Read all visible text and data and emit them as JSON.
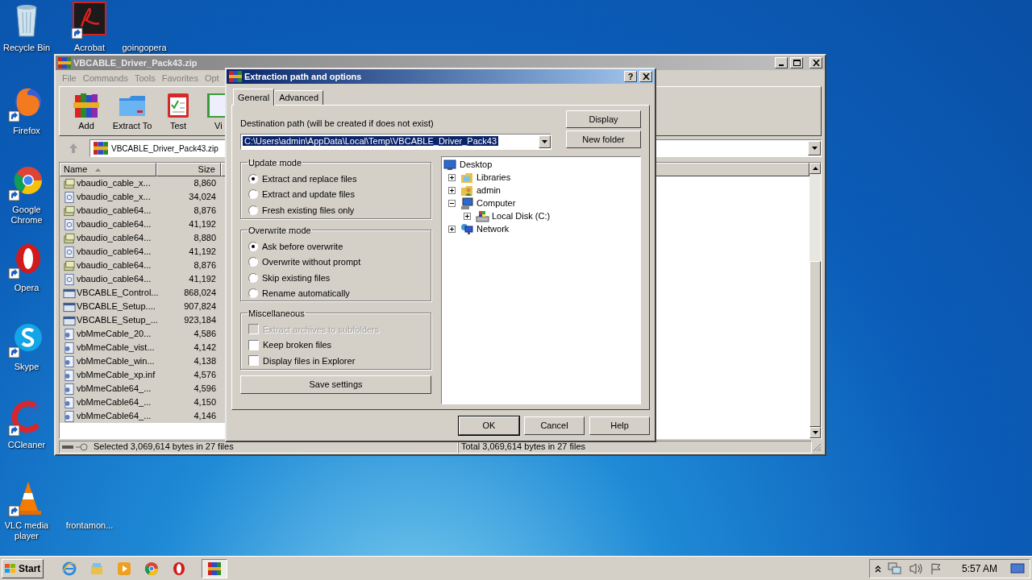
{
  "desktop_icons": [
    {
      "label": "Recycle Bin"
    },
    {
      "label": "Acrobat"
    },
    {
      "label": "goingopera"
    },
    {
      "label": "Firefox"
    },
    {
      "label": "Google Chrome"
    },
    {
      "label": "Opera"
    },
    {
      "label": "Skype"
    },
    {
      "label": "CCleaner"
    },
    {
      "label": "VLC media player"
    },
    {
      "label": "frontamon..."
    }
  ],
  "archive_window": {
    "title": "VBCABLE_Driver_Pack43.zip",
    "menu": [
      "File",
      "Commands",
      "Tools",
      "Favorites",
      "Opt"
    ],
    "toolbar": [
      "Add",
      "Extract To",
      "Test",
      "Vi"
    ],
    "address": "VBCABLE_Driver_Pack43.zip",
    "columns": [
      "Name",
      "Size"
    ],
    "rows": [
      {
        "name": "vbaudio_cable_x...",
        "size": "8,860",
        "kind": "cat",
        "selected": true
      },
      {
        "name": "vbaudio_cable_x...",
        "size": "34,024",
        "kind": "sys",
        "selected": true
      },
      {
        "name": "vbaudio_cable64...",
        "size": "8,876",
        "kind": "cat",
        "selected": true
      },
      {
        "name": "vbaudio_cable64...",
        "size": "41,192",
        "kind": "sys",
        "selected": true
      },
      {
        "name": "vbaudio_cable64...",
        "size": "8,880",
        "kind": "cat",
        "selected": true
      },
      {
        "name": "vbaudio_cable64...",
        "size": "41,192",
        "kind": "sys",
        "selected": true
      },
      {
        "name": "vbaudio_cable64...",
        "size": "8,876",
        "kind": "cat",
        "selected": true
      },
      {
        "name": "vbaudio_cable64...",
        "size": "41,192",
        "kind": "sys",
        "selected": true
      },
      {
        "name": "VBCABLE_Control...",
        "size": "868,024",
        "kind": "exe",
        "selected": true
      },
      {
        "name": "VBCABLE_Setup....",
        "size": "907,824",
        "kind": "exe",
        "selected": true
      },
      {
        "name": "VBCABLE_Setup_...",
        "size": "923,184",
        "kind": "exe",
        "selected": true
      },
      {
        "name": "vbMmeCable_20...",
        "size": "4,586",
        "kind": "inf",
        "selected": true
      },
      {
        "name": "vbMmeCable_vist...",
        "size": "4,142",
        "kind": "inf",
        "selected": true
      },
      {
        "name": "vbMmeCable_win...",
        "size": "4,138",
        "kind": "inf",
        "selected": true
      },
      {
        "name": "vbMmeCable_xp.inf",
        "size": "4,576",
        "kind": "inf",
        "selected": true
      },
      {
        "name": "vbMmeCable64_...",
        "size": "4,596",
        "kind": "inf",
        "selected": true
      },
      {
        "name": "vbMmeCable64_...",
        "size": "4,150",
        "kind": "inf",
        "selected": true
      },
      {
        "name": "vbMmeCable64_...",
        "size": "4,146",
        "kind": "inf",
        "selected": true
      }
    ],
    "status_left": "Selected 3,069,614 bytes in 27 files",
    "status_right": "Total 3,069,614 bytes in 27 files"
  },
  "dialog": {
    "title": "Extraction path and options",
    "help_glyph": "?",
    "tabs": [
      {
        "label": "General",
        "selected": true
      },
      {
        "label": "Advanced",
        "selected": false
      }
    ],
    "destination_label": "Destination path (will be created if does not exist)",
    "destination_value": "C:\\Users\\admin\\AppData\\Local\\Temp\\VBCABLE_Driver_Pack43",
    "side_buttons": [
      "Display",
      "New folder"
    ],
    "update_mode": {
      "title": "Update mode",
      "options": [
        {
          "label": "Extract and replace files",
          "selected": true
        },
        {
          "label": "Extract and update files",
          "selected": false
        },
        {
          "label": "Fresh existing files only",
          "selected": false
        }
      ]
    },
    "overwrite_mode": {
      "title": "Overwrite mode",
      "options": [
        {
          "label": "Ask before overwrite",
          "selected": true
        },
        {
          "label": "Overwrite without prompt",
          "selected": false
        },
        {
          "label": "Skip existing files",
          "selected": false
        },
        {
          "label": "Rename automatically",
          "selected": false
        }
      ]
    },
    "miscellaneous": {
      "title": "Miscellaneous",
      "options": [
        {
          "label": "Extract archives to subfolders",
          "checked": false,
          "disabled": true
        },
        {
          "label": "Keep broken files",
          "checked": false,
          "disabled": false
        },
        {
          "label": "Display files in Explorer",
          "checked": false,
          "disabled": false
        }
      ]
    },
    "save_button": "Save settings",
    "folder_tree": [
      {
        "label": "Desktop",
        "children": [
          {
            "label": "Libraries",
            "expanded": false
          },
          {
            "label": "admin",
            "expanded": false
          },
          {
            "label": "Computer",
            "expanded": true,
            "children": [
              {
                "label": "Local Disk (C:)",
                "expanded": false
              }
            ]
          },
          {
            "label": "Network",
            "expanded": false
          }
        ]
      }
    ],
    "buttons": [
      {
        "label": "OK",
        "default": true
      },
      {
        "label": "Cancel",
        "default": false
      },
      {
        "label": "Help",
        "default": false
      }
    ]
  },
  "taskbar": {
    "start": "Start",
    "apps": [
      {
        "active": false
      },
      {
        "active": false
      },
      {
        "active": false
      },
      {
        "active": false
      },
      {
        "active": false
      },
      {
        "active": true
      }
    ],
    "clock": "5:57 AM"
  }
}
